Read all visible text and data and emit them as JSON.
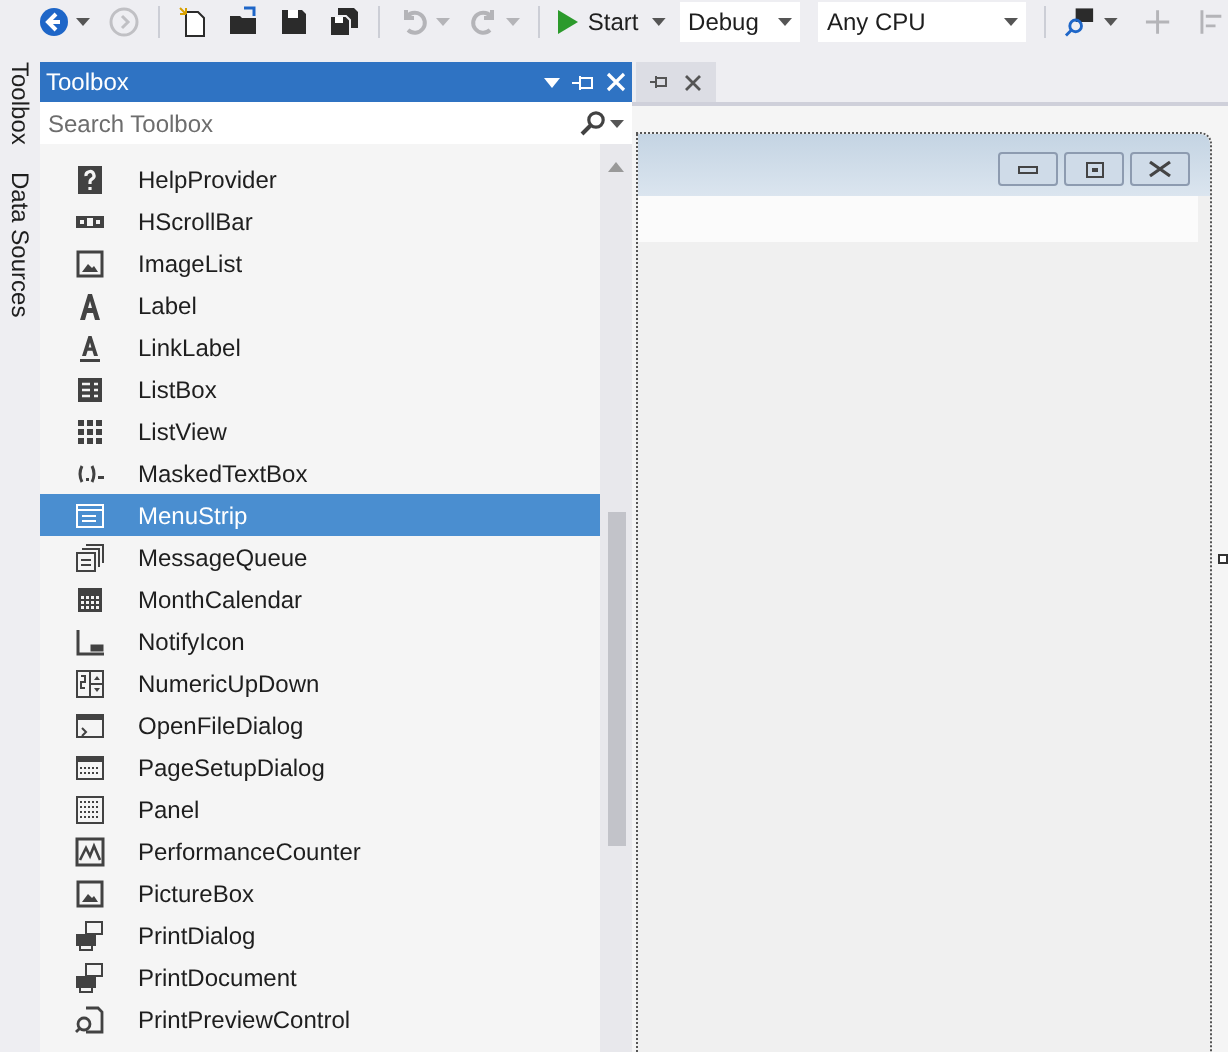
{
  "toolbar": {
    "buttons": [
      {
        "kind": "back",
        "disabled": false,
        "dropdown": true
      },
      {
        "kind": "forward",
        "disabled": true,
        "dropdown": false
      },
      {
        "kind": "new-project",
        "disabled": false,
        "dropdown": false
      },
      {
        "kind": "open",
        "disabled": false,
        "dropdown": false
      },
      {
        "kind": "save",
        "disabled": false,
        "dropdown": false
      },
      {
        "kind": "save-all",
        "disabled": false,
        "dropdown": false
      },
      {
        "kind": "undo",
        "disabled": true,
        "dropdown": true
      },
      {
        "kind": "redo",
        "disabled": true,
        "dropdown": true
      }
    ],
    "start": {
      "label": "Start"
    },
    "configuration": "Debug",
    "platform": "Any CPU"
  },
  "side_tabs": [
    "Toolbox",
    "Data Sources"
  ],
  "toolbox": {
    "title": "Toolbox",
    "search": {
      "placeholder": "Search Toolbox"
    },
    "items": [
      {
        "label": "HelpProvider",
        "kind": "help",
        "selected": false
      },
      {
        "label": "HScrollBar",
        "kind": "hscroll",
        "selected": false
      },
      {
        "label": "ImageList",
        "kind": "image",
        "selected": false
      },
      {
        "label": "Label",
        "kind": "letter",
        "selected": false
      },
      {
        "label": "LinkLabel",
        "kind": "link-letter",
        "selected": false
      },
      {
        "label": "ListBox",
        "kind": "listbox",
        "selected": false
      },
      {
        "label": "ListView",
        "kind": "dots",
        "selected": false
      },
      {
        "label": "MaskedTextBox",
        "kind": "masked",
        "selected": false
      },
      {
        "label": "MenuStrip",
        "kind": "menu",
        "selected": true
      },
      {
        "label": "MessageQueue",
        "kind": "queue",
        "selected": false
      },
      {
        "label": "MonthCalendar",
        "kind": "calendar",
        "selected": false
      },
      {
        "label": "NotifyIcon",
        "kind": "notify",
        "selected": false
      },
      {
        "label": "NumericUpDown",
        "kind": "numeric",
        "selected": false
      },
      {
        "label": "OpenFileDialog",
        "kind": "dialog",
        "selected": false
      },
      {
        "label": "PageSetupDialog",
        "kind": "page",
        "selected": false
      },
      {
        "label": "Panel",
        "kind": "grid",
        "selected": false
      },
      {
        "label": "PerformanceCounter",
        "kind": "chart",
        "selected": false
      },
      {
        "label": "PictureBox",
        "kind": "image",
        "selected": false
      },
      {
        "label": "PrintDialog",
        "kind": "printer",
        "selected": false
      },
      {
        "label": "PrintDocument",
        "kind": "printer",
        "selected": false
      },
      {
        "label": "PrintPreviewControl",
        "kind": "preview",
        "selected": false
      }
    ]
  }
}
